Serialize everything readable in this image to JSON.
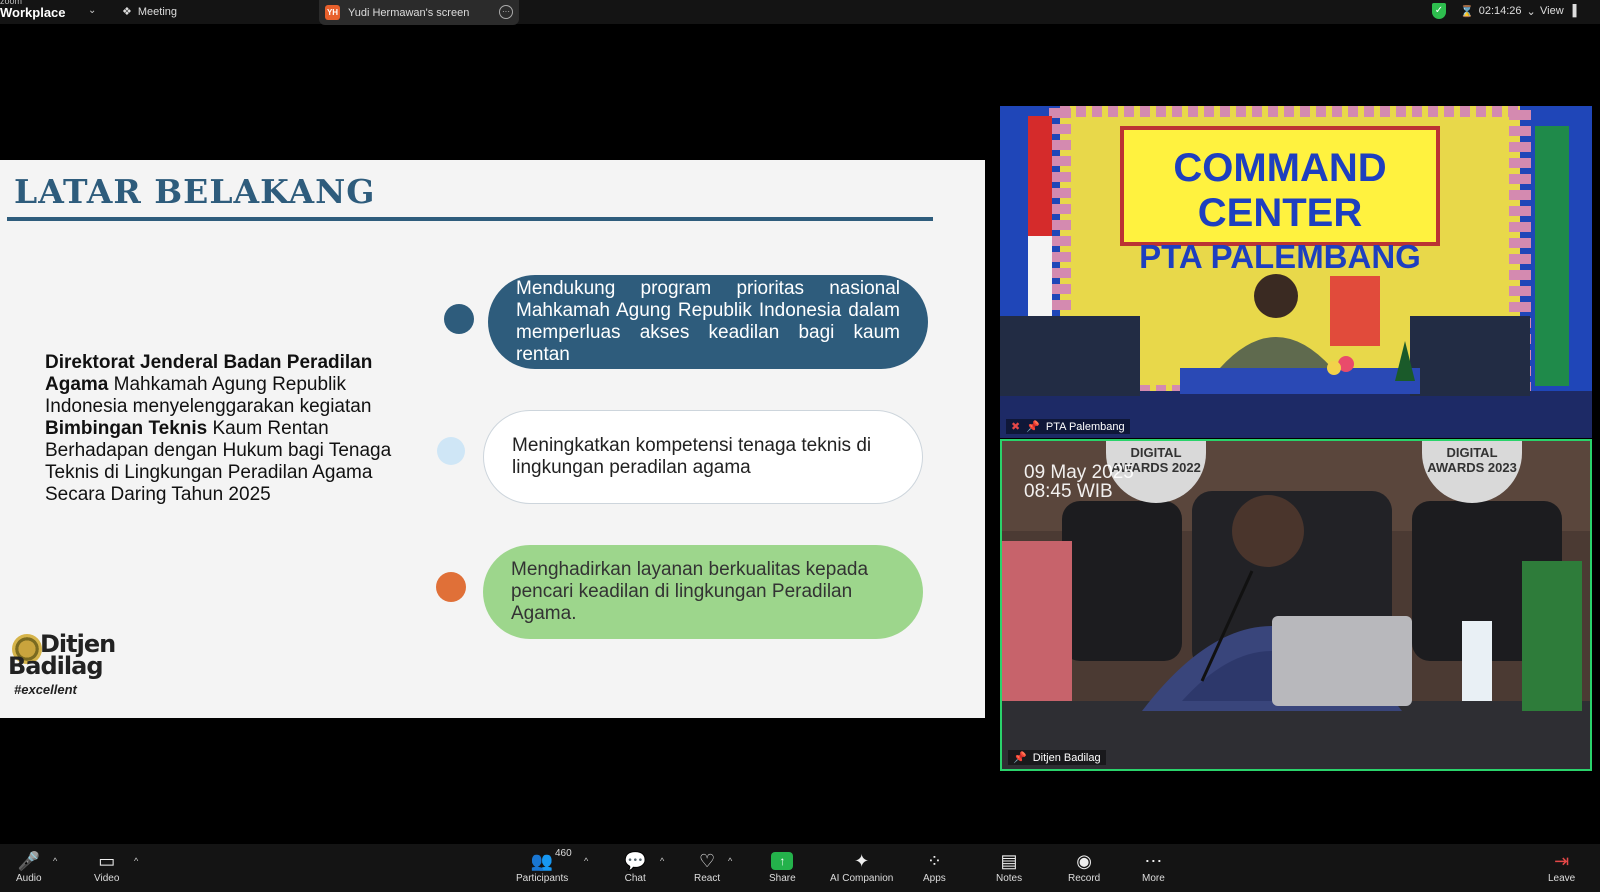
{
  "topbar": {
    "brand_top": "zoom",
    "brand_bottom": "Workplace",
    "meeting_label": "Meeting",
    "screen_initials": "YH",
    "screen_title": "Yudi Hermawan's screen",
    "timer": "02:14:26",
    "view_label": "View"
  },
  "slide": {
    "title": "LATAR BELAKANG",
    "intro_bold1": "Direktorat Jenderal Badan Peradilan Agama",
    "intro_text1": " Mahkamah Agung Republik Indonesia menyelenggarakan kegiatan ",
    "intro_bold2": "Bimbingan Teknis",
    "intro_text2": " Kaum Rentan Berhadapan dengan Hukum bagi Tenaga Teknis di Lingkungan Peradilan Agama Secara Daring Tahun 2025",
    "points": [
      "Mendukung program prioritas nasional Mahkamah Agung Republik Indonesia dalam memperluas akses keadilan bagi kaum rentan",
      "Meningkatkan kompetensi tenaga teknis di lingkungan peradilan agama",
      "Menghadirkan layanan berkualitas kepada pencari keadilan di lingkungan Peradilan Agama."
    ],
    "logo_line1": "Ditjen",
    "logo_line2": "Badilag",
    "logo_tag": "#excellent",
    "colors": {
      "title": "#2e5c7c",
      "point1": "#2e5c7c",
      "point2": "#ffffff",
      "point3": "#9dd68c",
      "dot1": "#2e5c7c",
      "dot2": "#cfe6f6",
      "dot3": "#e07038"
    }
  },
  "videos": [
    {
      "name": "PTA Palembang",
      "banner_line1": "COMMAND CENTER",
      "banner_line2": "PTA PALEMBANG"
    },
    {
      "name": "Ditjen Badilag",
      "date": "09 May 2025",
      "time": "08:45 WIB",
      "award_left": "DIGITAL AWARDS 2022",
      "award_right": "DIGITAL AWARDS 2023"
    }
  ],
  "toolbar": {
    "audio": "Audio",
    "video": "Video",
    "participants": "Participants",
    "participant_count": "460",
    "chat": "Chat",
    "react": "React",
    "share": "Share",
    "ai_companion": "AI Companion",
    "apps": "Apps",
    "notes": "Notes",
    "record": "Record",
    "more": "More",
    "leave": "Leave"
  }
}
